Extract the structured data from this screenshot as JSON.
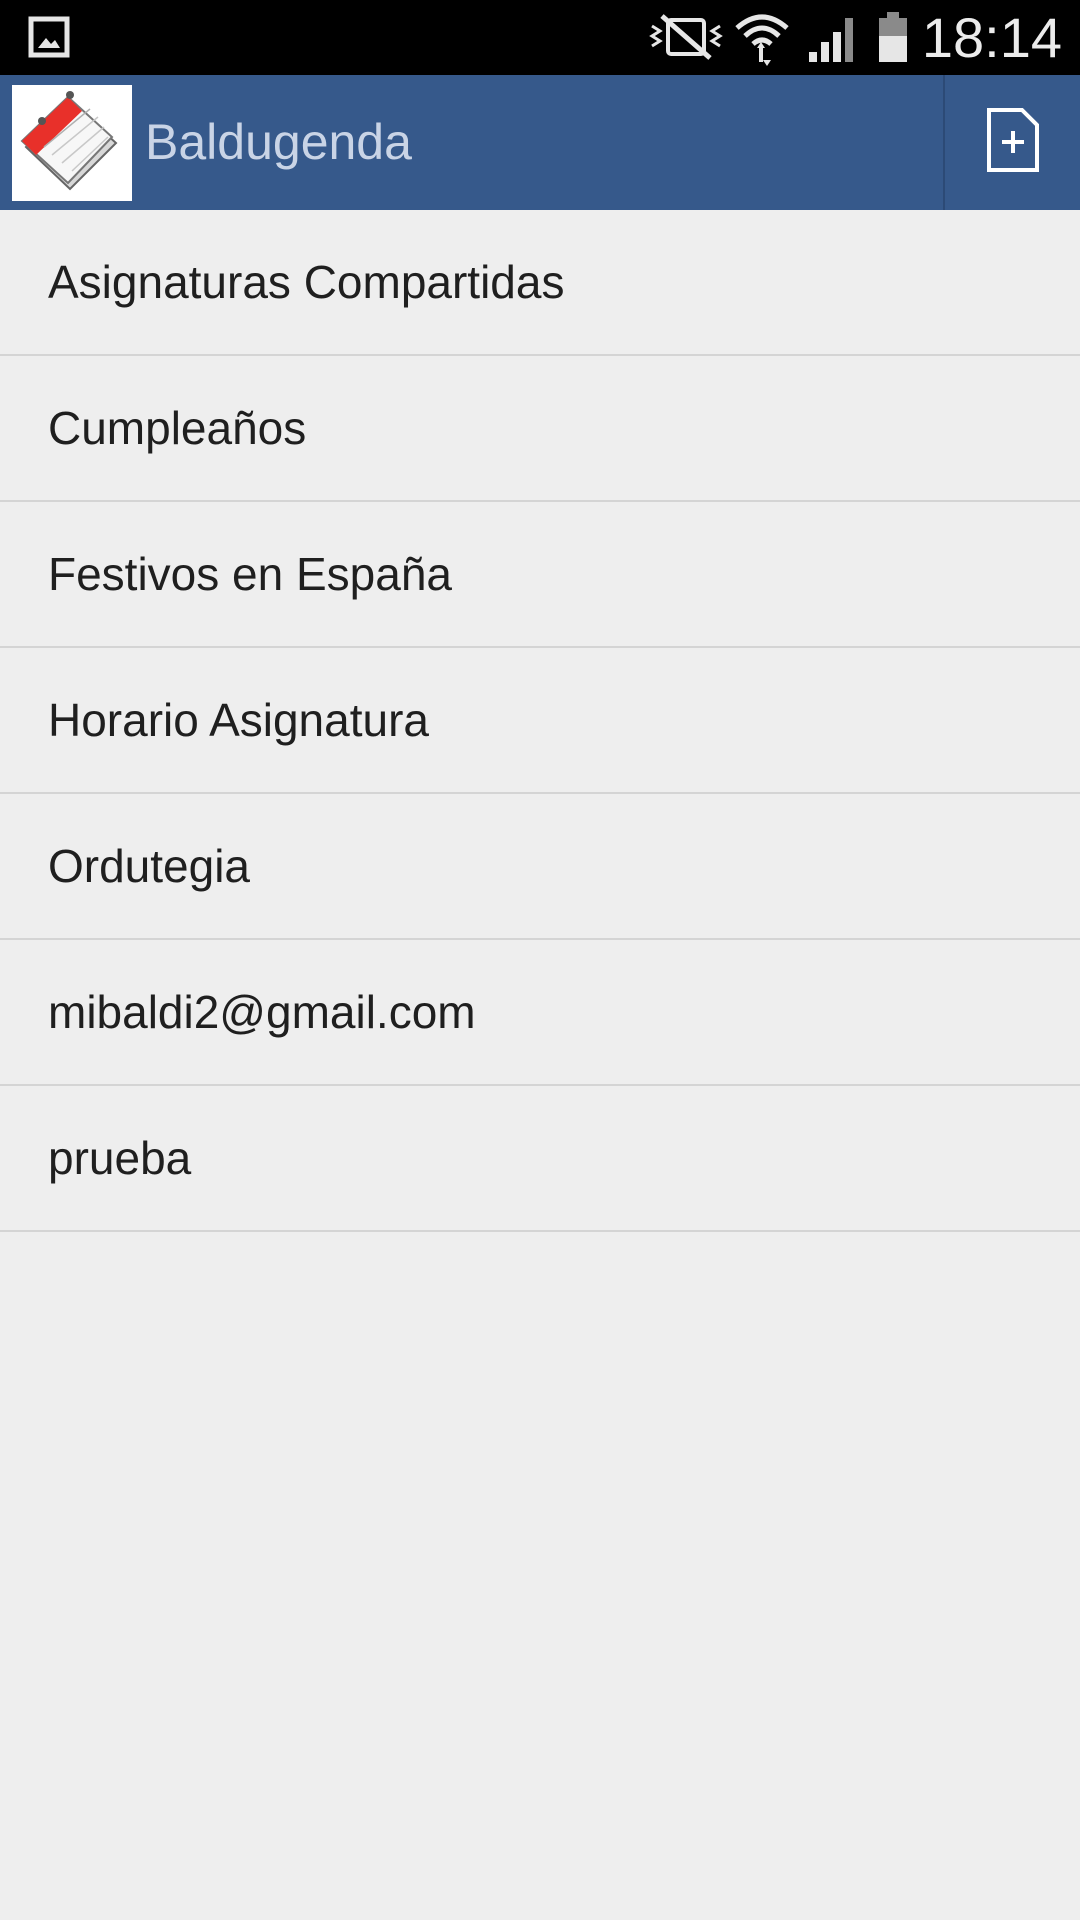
{
  "status_bar": {
    "time": "18:14",
    "icons": [
      "gallery-icon",
      "mute-vibrate-icon",
      "wifi-icon",
      "signal-icon",
      "battery-icon"
    ]
  },
  "action_bar": {
    "title": "Baldugenda",
    "logo_icon": "agenda-calendar-icon",
    "action_icon": "new-document-icon"
  },
  "list": {
    "items": [
      {
        "label": "Asignaturas Compartidas"
      },
      {
        "label": "Cumpleaños"
      },
      {
        "label": "Festivos en España"
      },
      {
        "label": "Horario Asignatura"
      },
      {
        "label": "Ordutegia"
      },
      {
        "label": "mibaldi2@gmail.com"
      },
      {
        "label": "prueba"
      }
    ]
  },
  "colors": {
    "status_bar": "#000000",
    "action_bar": "#36598b",
    "background": "#eeeeee",
    "divider": "#d4d4d4",
    "text": "#1f1f1f"
  }
}
